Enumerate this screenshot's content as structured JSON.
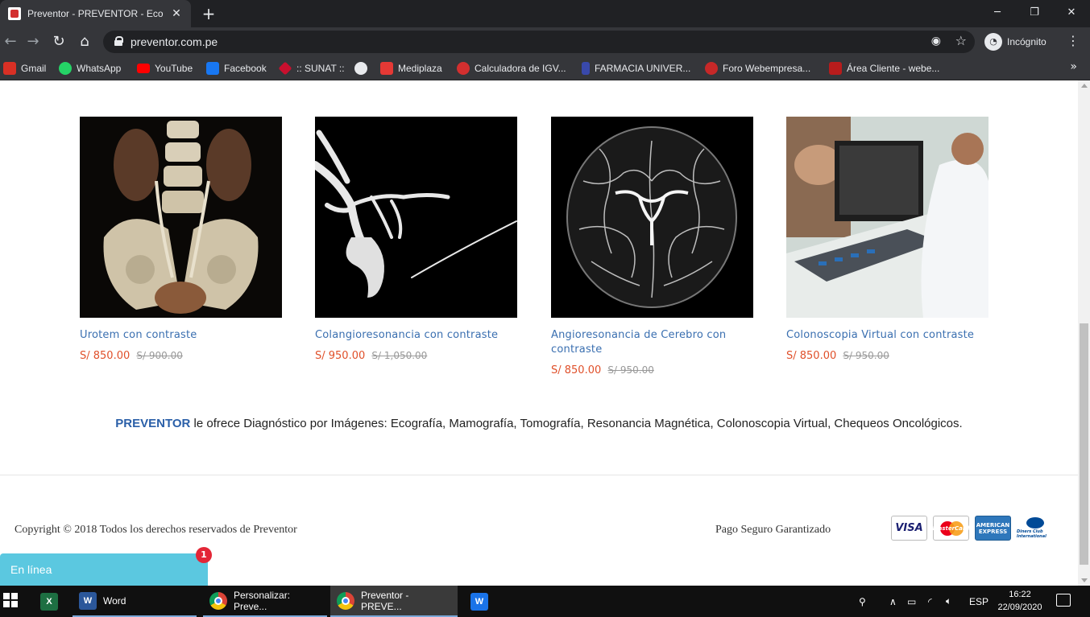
{
  "browser": {
    "tab_title": "Preventor - PREVENTOR - Ecografía",
    "tab_close": "✕",
    "new_tab": "+",
    "url": "preventor.com.pe",
    "incognito_label": "Incógnito"
  },
  "bookmarks": [
    {
      "label": "Gmail",
      "color": "#d93025"
    },
    {
      "label": "WhatsApp",
      "color": "#25d366"
    },
    {
      "label": "YouTube",
      "color": "#ff0000"
    },
    {
      "label": "Facebook",
      "color": "#1877f2"
    },
    {
      "label": ":: SUNAT ::",
      "color": "#c8102e"
    },
    {
      "label": "",
      "color": "#9aa0a6"
    },
    {
      "label": "Mediplaza",
      "color": "#e53935"
    },
    {
      "label": "Calculadora de IGV...",
      "color": "#d32f2f"
    },
    {
      "label": "FARMACIA UNIVER...",
      "color": "#3949ab"
    },
    {
      "label": "Foro Webempresa...",
      "color": "#c62828"
    },
    {
      "label": "Área Cliente - webe...",
      "color": "#b71c1c"
    }
  ],
  "products": [
    {
      "name": "Urotem con contraste",
      "price": "S/ 850.00",
      "old_price": "S/ 900.00"
    },
    {
      "name": "Colangioresonancia con contraste",
      "price": "S/ 950.00",
      "old_price": "S/ 1,050.00"
    },
    {
      "name": "Angioresonancia de Cerebro con contraste",
      "price": "S/ 850.00",
      "old_price": "S/ 950.00"
    },
    {
      "name": "Colonoscopia Virtual con contraste",
      "price": "S/ 850.00",
      "old_price": "S/ 950.00"
    }
  ],
  "tagline": {
    "brand": "PREVENTOR",
    "text": " le ofrece Diagnóstico por Imágenes: Ecografía, Mamografía, Tomografía, Resonancia Magnética, Colonoscopia Virtual, Chequeos Oncológicos."
  },
  "footer": {
    "copyright": "Copyright © 2018 Todos los derechos reservados de Preventor",
    "secure": "Pago Seguro Garantizado",
    "cards": {
      "visa": "VISA",
      "mastercard": "MasterCard",
      "amex": "AMERICAN EXPRESS",
      "diners": "Diners Club International"
    }
  },
  "chat": {
    "label": "En línea",
    "badge": "1"
  },
  "taskbar": {
    "word": "Word",
    "chrome1": "Personalizar: Preve...",
    "chrome2": "Preventor - PREVE...",
    "lang": "ESP",
    "time": "16:22",
    "date": "22/09/2020"
  },
  "colors": {
    "accent": "#3a6fb0",
    "price": "#e0502a",
    "chat": "#5bc8e0",
    "brand": "#2a5fa8"
  }
}
